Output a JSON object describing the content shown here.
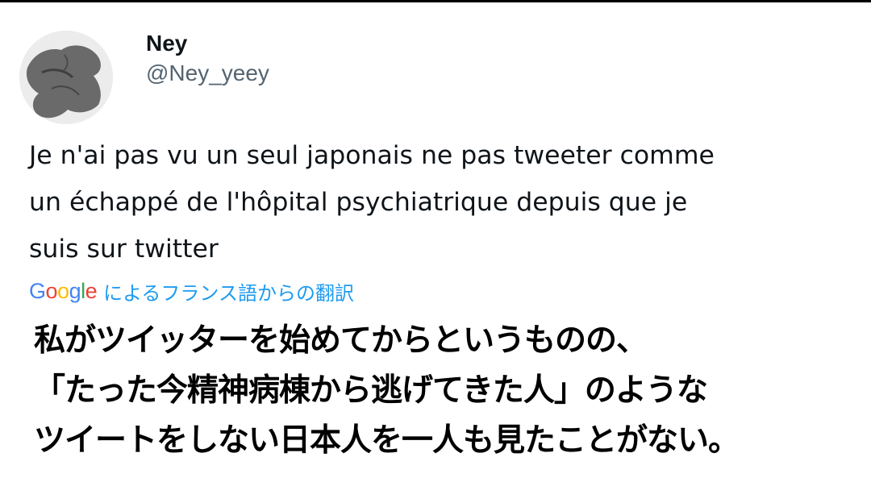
{
  "tweet": {
    "author": {
      "display_name": "Ney",
      "handle": "@Ney_yeey",
      "avatar_icon": "avatar-image"
    },
    "text_lines": [
      "Je n'ai pas vu un seul japonais ne pas tweeter comme",
      "un échappé de l'hôpital psychiatrique depuis que je",
      "suis sur twitter"
    ],
    "translation": {
      "provider_letters": [
        "G",
        "o",
        "o",
        "g",
        "l",
        "e"
      ],
      "provider_colors": [
        "#4285f4",
        "#ea4335",
        "#fbbc05",
        "#4285f4",
        "#34a853",
        "#ea4335"
      ],
      "label": "によるフランス語からの翻訳"
    },
    "translated_lines": [
      "私がツイッターを始めてからというものの、",
      "「たった今精神病棟から逃げてきた人」のような",
      "ツイートをしない日本人を一人も見たことがない。"
    ]
  },
  "colors": {
    "text_primary": "#0f1419",
    "text_secondary": "#536471",
    "link_blue": "#1d9bf0"
  }
}
